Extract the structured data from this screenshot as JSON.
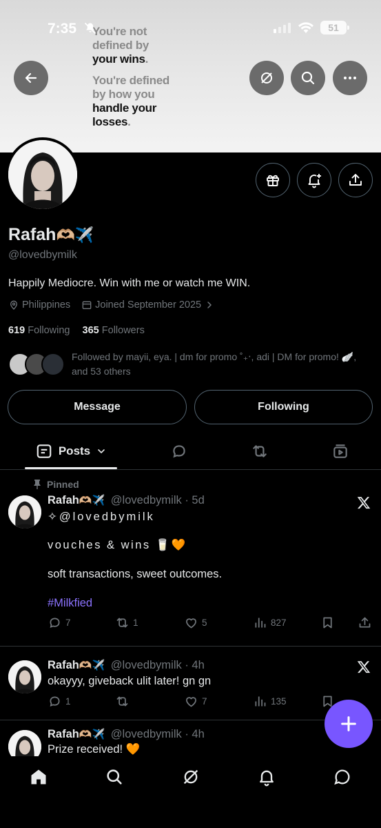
{
  "status_bar": {
    "time": "7:35",
    "battery": "51"
  },
  "banner": {
    "lines_1": [
      "You're not",
      "defined by"
    ],
    "lines_1_bold": "your wins",
    "lines_2": [
      "You're defined",
      "by how you"
    ],
    "lines_2_bold": [
      "handle your",
      "losses"
    ]
  },
  "profile": {
    "name": "Rafah",
    "name_emoji": "🫶🏼✈️",
    "handle": "@lovedbymilk",
    "bio": "Happily Mediocre. Win with me or watch me WIN.",
    "location": "Philippines",
    "joined": "Joined September 2025",
    "following_count": "619",
    "following_label": "Following",
    "followers_count": "365",
    "followers_label": "Followers",
    "followed_by": "Followed by mayii, eya. | dm for promo ˚₊‧, adi | DM for promo! 🪽, and 53 others"
  },
  "buttons": {
    "message": "Message",
    "following": "Following"
  },
  "tabs": {
    "posts": "Posts"
  },
  "posts": [
    {
      "pinned_label": "Pinned",
      "name": "Rafah",
      "emoji": "🫶🏼✈️",
      "handle": "@lovedbymilk",
      "time": "5d",
      "lines": [
        "✧@lovedbymilk",
        "vouches & wins 🥛🧡",
        "soft transactions, sweet outcomes."
      ],
      "hashtag": "#Milkfied",
      "replies": "7",
      "reposts": "1",
      "likes": "5",
      "views": "827"
    },
    {
      "name": "Rafah",
      "emoji": "🫶🏼✈️",
      "handle": "@lovedbymilk",
      "time": "4h",
      "text": "okayyy, giveback ulit later! gn gn",
      "replies": "1",
      "reposts": "",
      "likes": "7",
      "views": "135"
    },
    {
      "name": "Rafah",
      "emoji": "🫶🏼✈️",
      "handle": "@lovedbymilk",
      "time": "4h",
      "text": "Prize received! 🧡"
    }
  ],
  "colors": {
    "accent": "#7856ff",
    "link": "#8c73ff",
    "muted": "#71767b",
    "border": "#2f3336"
  },
  "icons": [
    "back-arrow-icon",
    "grok-icon",
    "search-icon",
    "more-icon",
    "gift-icon",
    "bell-plus-icon",
    "share-icon",
    "location-icon",
    "calendar-icon",
    "posts-icon",
    "reply-icon",
    "repost-icon",
    "media-icon",
    "like-icon",
    "views-icon",
    "bookmark-icon",
    "x-logo-icon",
    "plus-icon",
    "home-icon",
    "notifications-icon",
    "messages-icon"
  ]
}
